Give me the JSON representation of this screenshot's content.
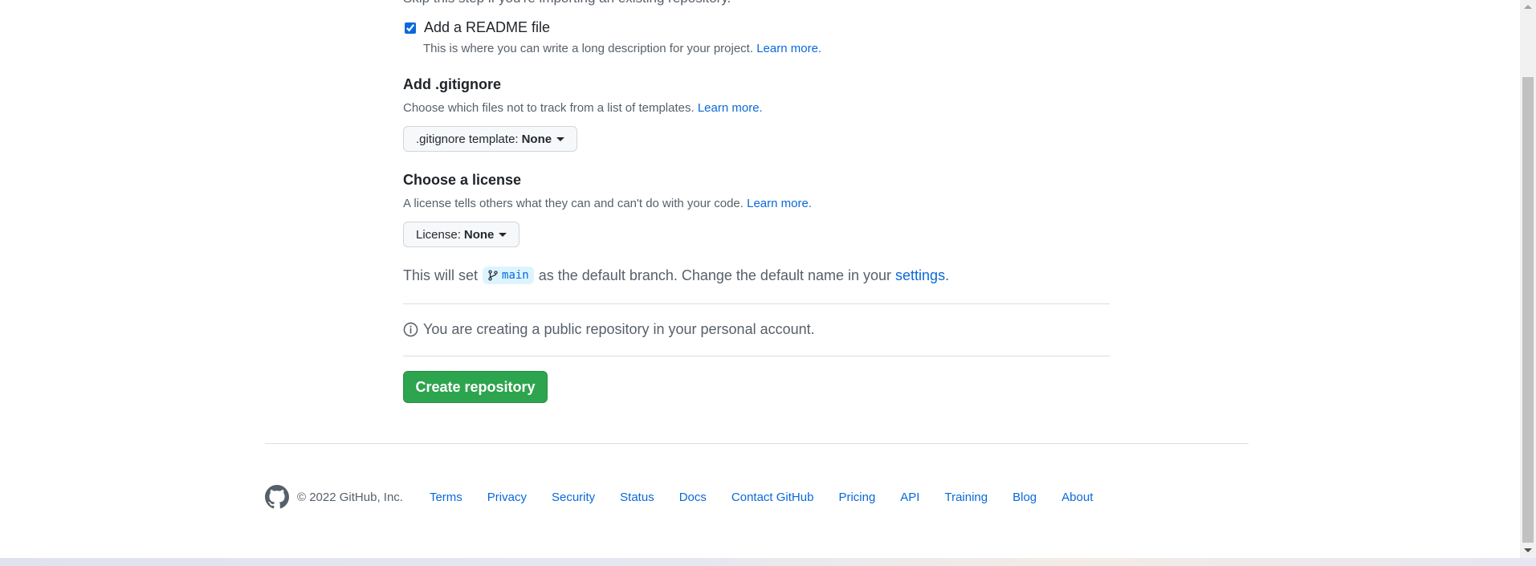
{
  "form": {
    "clipped_text": "Skip this step if you're importing an existing repository.",
    "readme": {
      "label": "Add a README file",
      "checked": true,
      "description": "This is where you can write a long description for your project.",
      "learn_more": "Learn more."
    },
    "gitignore": {
      "title": "Add .gitignore",
      "description": "Choose which files not to track from a list of templates.",
      "learn_more": "Learn more.",
      "select_label": ".gitignore template:",
      "select_value": "None"
    },
    "license": {
      "title": "Choose a license",
      "description": "A license tells others what they can and can't do with your code.",
      "learn_more": "Learn more.",
      "select_label": "License:",
      "select_value": "None"
    },
    "branch": {
      "prefix": "This will set",
      "branch_name": "main",
      "suffix": "as the default branch. Change the default name in your",
      "settings_link": "settings",
      "period": "."
    },
    "info": "You are creating a public repository in your personal account.",
    "create_button": "Create repository"
  },
  "footer": {
    "copyright": "© 2022 GitHub, Inc.",
    "links": [
      "Terms",
      "Privacy",
      "Security",
      "Status",
      "Docs",
      "Contact GitHub",
      "Pricing",
      "API",
      "Training",
      "Blog",
      "About"
    ]
  },
  "colors": {
    "link": "#0969da",
    "primary_button": "#2da44e",
    "muted_text": "#57606a"
  }
}
